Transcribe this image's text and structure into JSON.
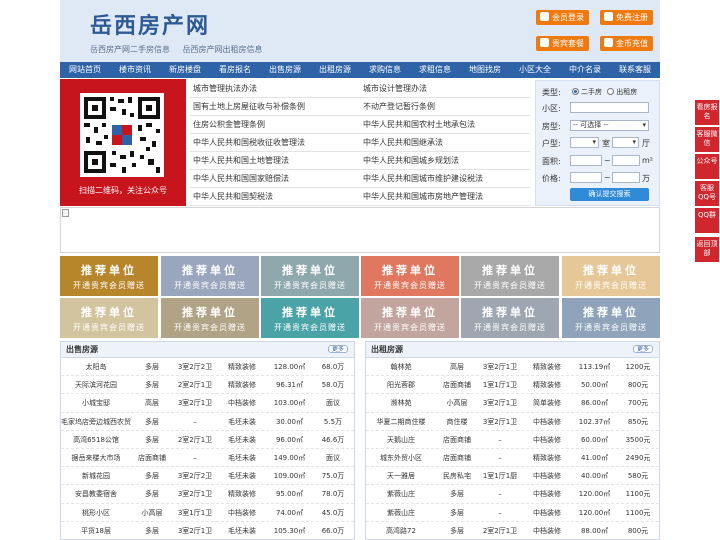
{
  "site": {
    "logo": "岳西房产网",
    "tagline": [
      "岳西房产网二手房信息",
      "岳西房产网出租房信息"
    ]
  },
  "header_buttons": {
    "member_login": "会员登录",
    "free_register": "免费注册",
    "vip_package": "贵宾套餐",
    "gold_recharge": "金币充值"
  },
  "nav": [
    "网站首页",
    "楼市资讯",
    "新房楼盘",
    "看房报名",
    "出售房源",
    "出租房源",
    "求购信息",
    "求租信息",
    "地图找房",
    "小区大全",
    "中介名录",
    "联系客服"
  ],
  "qr": {
    "caption": "扫描二维码，关注公众号"
  },
  "links": [
    [
      "城市管理执法办法",
      "城市设计管理办法"
    ],
    [
      "国有土地上房屋征收与补偿条例",
      "不动产登记暂行条例"
    ],
    [
      "住房公积金管理条例",
      "中华人民共和国农村土地承包法"
    ],
    [
      "中华人民共和国税收征收管理法",
      "中华人民共和国继承法"
    ],
    [
      "中华人民共和国土地管理法",
      "中华人民共和国城乡规划法"
    ],
    [
      "中华人民共和国国家赔偿法",
      "中华人民共和国城市维护建设税法"
    ],
    [
      "中华人民共和国契税法",
      "中华人民共和国城市房地产管理法"
    ]
  ],
  "search": {
    "type_label": "类型:",
    "type_options": [
      "二手房",
      "出租房"
    ],
    "community_label": "小区:",
    "community_value": "",
    "housetype_label": "房型:",
    "housetype_select": "-- 可选择 --",
    "layout_label": "户型:",
    "room_unit": "室",
    "hall_unit": "厅",
    "area_label": "面积:",
    "area_unit": "m²",
    "price_label": "价格:",
    "price_unit": "万",
    "range_sep": "~",
    "submit": "确认提交搜索"
  },
  "promo": {
    "title": "推荐单位",
    "subtitle": "开通贵宾会员赠送",
    "colors": [
      "#b8862a",
      "#9aa6bd",
      "#8fa8ad",
      "#e07860",
      "#a8a8a8",
      "#e6c898",
      "#d3c4a0",
      "#b1a386",
      "#4aa3a6",
      "#c2a59e",
      "#9ea7b1",
      "#8fa4ba"
    ]
  },
  "sale": {
    "title": "出售房源",
    "more": "更多",
    "rows": [
      [
        "太阳岛",
        "多层",
        "3室2厅2卫",
        "精致装修",
        "128.00㎡",
        "68.0万"
      ],
      [
        "天际滨河花园",
        "多层",
        "2室2厅1卫",
        "精致装修",
        "96.31㎡",
        "58.0万"
      ],
      [
        "小城宝邸",
        "高层",
        "3室2厅1卫",
        "中档装修",
        "103.00㎡",
        "面议"
      ],
      [
        "毛家坞店旁边城西农贸",
        "多层",
        "–",
        "毛坯未装",
        "30.00㎡",
        "5.5万"
      ],
      [
        "高湾6518公馆",
        "多层",
        "2室2厅1卫",
        "毛坯未装",
        "96.00㎡",
        "46.6万"
      ],
      [
        "据岳来楼大市场",
        "店面商铺",
        "–",
        "毛坯未装",
        "149.00㎡",
        "面议"
      ],
      [
        "新城花园",
        "多层",
        "3室2厅2卫",
        "毛坯未装",
        "109.00㎡",
        "75.0万"
      ],
      [
        "安昌教委宿舍",
        "多层",
        "3室2厅1卫",
        "精致装修",
        "95.00㎡",
        "78.0万"
      ],
      [
        "桃形小区",
        "小高层",
        "3室1厅1卫",
        "中档装修",
        "74.00㎡",
        "45.0万"
      ],
      [
        "平货18层",
        "多层",
        "3室2厅1卫",
        "毛坯未装",
        "105.30㎡",
        "66.0万"
      ]
    ]
  },
  "rent": {
    "title": "出租房源",
    "more": "更多",
    "rows": [
      [
        "翰林苑",
        "高层",
        "3室2厅1卫",
        "精致装修",
        "113.19㎡",
        "1200元"
      ],
      [
        "阳光蓉郡",
        "店面商铺",
        "1室1厅1卫",
        "精致装修",
        "50.00㎡",
        "800元"
      ],
      [
        "濒林苑",
        "小高层",
        "3室2厅1卫",
        "简单装修",
        "86.00㎡",
        "700元"
      ],
      [
        "华夏二期商住楼",
        "商住楼",
        "3室2厅1卫",
        "中档装修",
        "102.37㎡",
        "850元"
      ],
      [
        "天鹅山庄",
        "店面商铺",
        "–",
        "中档装修",
        "60.00㎡",
        "3500元"
      ],
      [
        "城东外贸小区",
        "店面商铺",
        "–",
        "精致装修",
        "41.00㎡",
        "2490元"
      ],
      [
        "天一雅居",
        "民房私宅",
        "1室1厅1厨",
        "中档装修",
        "40.00㎡",
        "580元"
      ],
      [
        "紫薇山庄",
        "多层",
        "–",
        "中档装修",
        "120.00㎡",
        "1100元"
      ],
      [
        "紫薇山庄",
        "多层",
        "–",
        "中档装修",
        "120.00㎡",
        "1100元"
      ],
      [
        "高湾路72",
        "多层",
        "2室2厅1卫",
        "中档装修",
        "88.00㎡",
        "800元"
      ]
    ]
  },
  "side": [
    "看房报名",
    "客服微信",
    "公众号",
    "客服QQ号",
    "QQ群",
    "返回顶部"
  ]
}
